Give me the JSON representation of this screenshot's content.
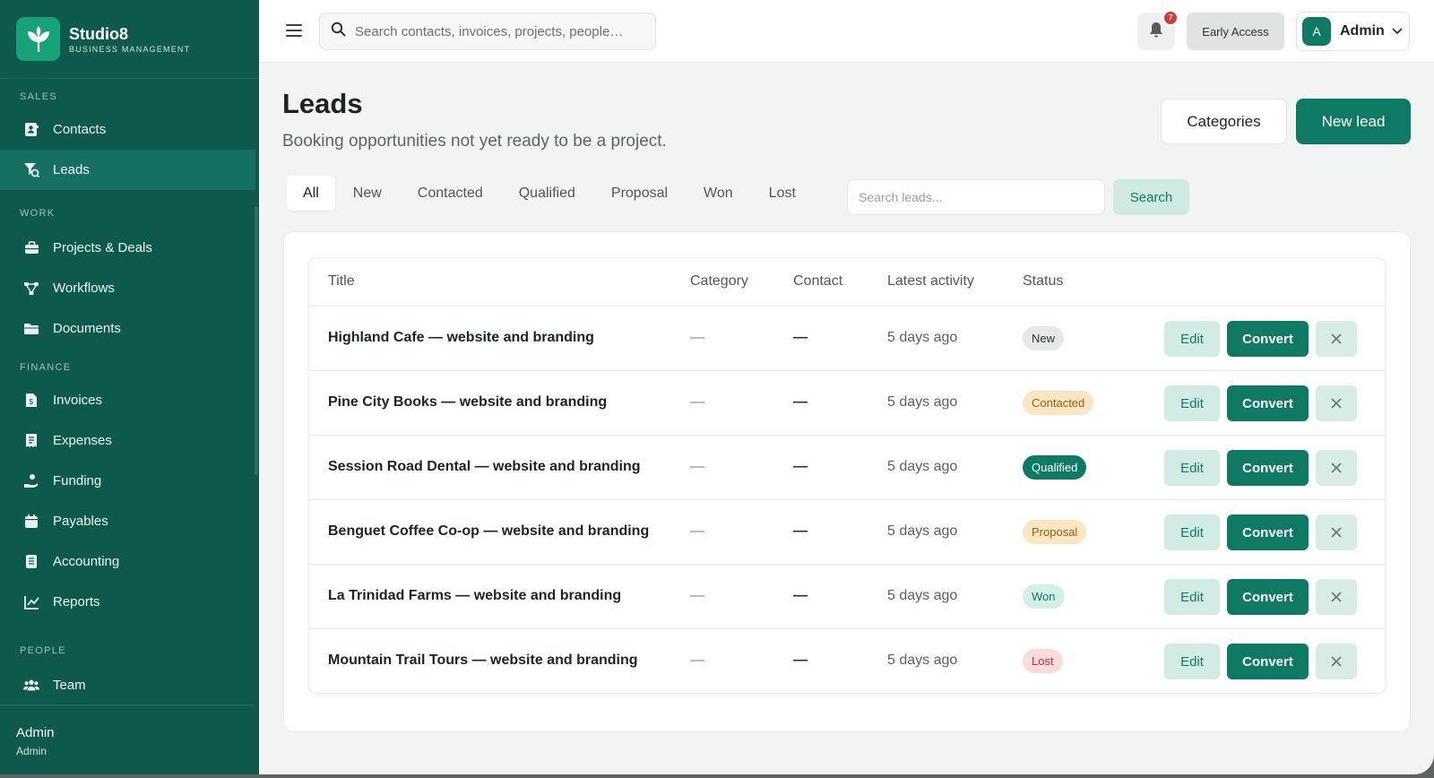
{
  "app": {
    "name": "Studio8",
    "subtitle": "BUSINESS MANAGEMENT"
  },
  "sidebar": {
    "sections": [
      {
        "label": "SALES",
        "items": [
          {
            "label": "Contacts",
            "icon": "contacts-icon"
          },
          {
            "label": "Leads",
            "icon": "leads-icon",
            "active": true
          }
        ]
      },
      {
        "label": "WORK",
        "items": [
          {
            "label": "Projects & Deals",
            "icon": "briefcase-icon"
          },
          {
            "label": "Workflows",
            "icon": "workflow-icon"
          },
          {
            "label": "Documents",
            "icon": "folder-icon"
          }
        ]
      },
      {
        "label": "FINANCE",
        "items": [
          {
            "label": "Invoices",
            "icon": "invoice-icon"
          },
          {
            "label": "Expenses",
            "icon": "receipt-icon"
          },
          {
            "label": "Funding",
            "icon": "funding-icon"
          },
          {
            "label": "Payables",
            "icon": "calendar-icon"
          },
          {
            "label": "Accounting",
            "icon": "ledger-icon"
          },
          {
            "label": "Reports",
            "icon": "chart-icon"
          }
        ]
      },
      {
        "label": "PEOPLE",
        "items": [
          {
            "label": "Team",
            "icon": "team-icon"
          }
        ]
      }
    ],
    "footer": {
      "name": "Admin",
      "role": "Admin"
    }
  },
  "topbar": {
    "search_placeholder": "Search contacts, invoices, projects, people…",
    "notifications_count": "7",
    "early_access": "Early Access",
    "user_initial": "A",
    "user_name": "Admin"
  },
  "page": {
    "title": "Leads",
    "subtitle": "Booking opportunities not yet ready to be a project.",
    "categories_label": "Categories",
    "new_lead_label": "New lead"
  },
  "filters": {
    "tabs": [
      "All",
      "New",
      "Contacted",
      "Qualified",
      "Proposal",
      "Won",
      "Lost"
    ],
    "active": "All",
    "search_placeholder": "Search leads...",
    "search_button": "Search"
  },
  "table": {
    "columns": [
      "Title",
      "Category",
      "Contact",
      "Latest activity",
      "Status"
    ],
    "actions": {
      "edit": "Edit",
      "convert": "Convert"
    },
    "rows": [
      {
        "title": "Highland Cafe — website and branding",
        "category": "—",
        "contact": "—",
        "activity": "5 days ago",
        "status": "New"
      },
      {
        "title": "Pine City Books — website and branding",
        "category": "—",
        "contact": "—",
        "activity": "5 days ago",
        "status": "Contacted"
      },
      {
        "title": "Session Road Dental — website and branding",
        "category": "—",
        "contact": "—",
        "activity": "5 days ago",
        "status": "Qualified"
      },
      {
        "title": "Benguet Coffee Co-op — website and branding",
        "category": "—",
        "contact": "—",
        "activity": "5 days ago",
        "status": "Proposal"
      },
      {
        "title": "La Trinidad Farms — website and branding",
        "category": "—",
        "contact": "—",
        "activity": "5 days ago",
        "status": "Won"
      },
      {
        "title": "Mountain Trail Tours — website and branding",
        "category": "—",
        "contact": "—",
        "activity": "5 days ago",
        "status": "Lost"
      }
    ]
  },
  "status_colors": {
    "New": {
      "bg": "#e6e9e8",
      "fg": "#2c3431"
    },
    "Contacted": {
      "bg": "#fbe6c4",
      "fg": "#9a5c12"
    },
    "Qualified": {
      "bg": "#0f7a64",
      "fg": "#ffffff"
    },
    "Proposal": {
      "bg": "#fbe6c4",
      "fg": "#9a5c12"
    },
    "Won": {
      "bg": "#d4efe6",
      "fg": "#0f7a64"
    },
    "Lost": {
      "bg": "#fadcdc",
      "fg": "#b83333"
    }
  },
  "colors": {
    "brand": "#0d594b",
    "accent": "#0f7a64"
  }
}
